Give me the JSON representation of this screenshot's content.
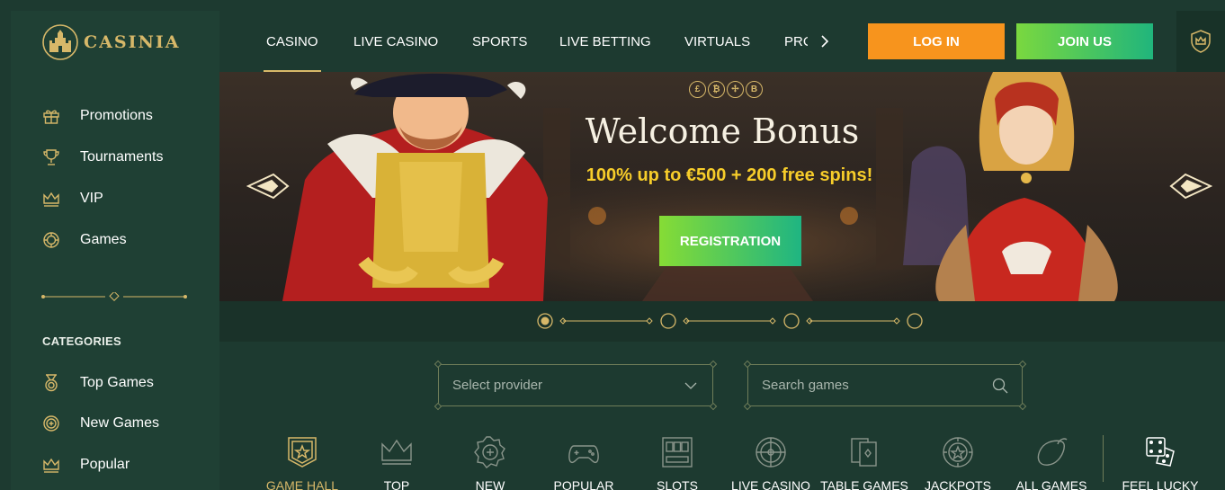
{
  "brand": {
    "name": "CASINIA",
    "gold": "#d7b869"
  },
  "sidebar": {
    "items": [
      {
        "label": "Promotions",
        "icon": "gift-icon"
      },
      {
        "label": "Tournaments",
        "icon": "trophy-icon"
      },
      {
        "label": "VIP",
        "icon": "crown-icon"
      },
      {
        "label": "Games",
        "icon": "chip-icon"
      }
    ],
    "categories_title": "CATEGORIES",
    "categories": [
      {
        "label": "Top Games",
        "icon": "medal-icon"
      },
      {
        "label": "New Games",
        "icon": "plus-chip-icon"
      },
      {
        "label": "Popular",
        "icon": "crown-icon"
      }
    ]
  },
  "header": {
    "nav": [
      {
        "label": "CASINO",
        "active": true
      },
      {
        "label": "LIVE CASINO"
      },
      {
        "label": "SPORTS"
      },
      {
        "label": "LIVE BETTING"
      },
      {
        "label": "VIRTUALS"
      },
      {
        "label": "PRC"
      }
    ],
    "login_label": "LOG IN",
    "join_label": "JOIN US",
    "login_color": "#f7941d",
    "join_color": "#20b57c"
  },
  "banner": {
    "title": "Welcome Bonus",
    "subtitle": "100% up to €500 + 200 free spins!",
    "cta_label": "REGISTRATION",
    "coins": [
      "£",
      "₿",
      "✢",
      "B"
    ],
    "slide_count": 4,
    "active_slide": 1
  },
  "filters": {
    "provider_placeholder": "Select provider",
    "search_placeholder": "Search games"
  },
  "game_tabs": [
    {
      "label": "GAME HALL",
      "icon": "shield-star-icon",
      "active": true
    },
    {
      "label": "TOP",
      "icon": "crown-icon"
    },
    {
      "label": "NEW",
      "icon": "plus-badge-icon"
    },
    {
      "label": "POPULAR",
      "icon": "gamepad-icon"
    },
    {
      "label": "SLOTS",
      "icon": "slot-machine-icon"
    },
    {
      "label": "LIVE CASINO",
      "icon": "roulette-icon"
    },
    {
      "label": "TABLE GAMES",
      "icon": "cards-icon"
    },
    {
      "label": "JACKPOTS",
      "icon": "jackpot-chip-icon"
    },
    {
      "label": "ALL GAMES",
      "icon": "lemon-icon"
    },
    {
      "label": "FEEL LUCKY",
      "icon": "dice-icon"
    }
  ]
}
